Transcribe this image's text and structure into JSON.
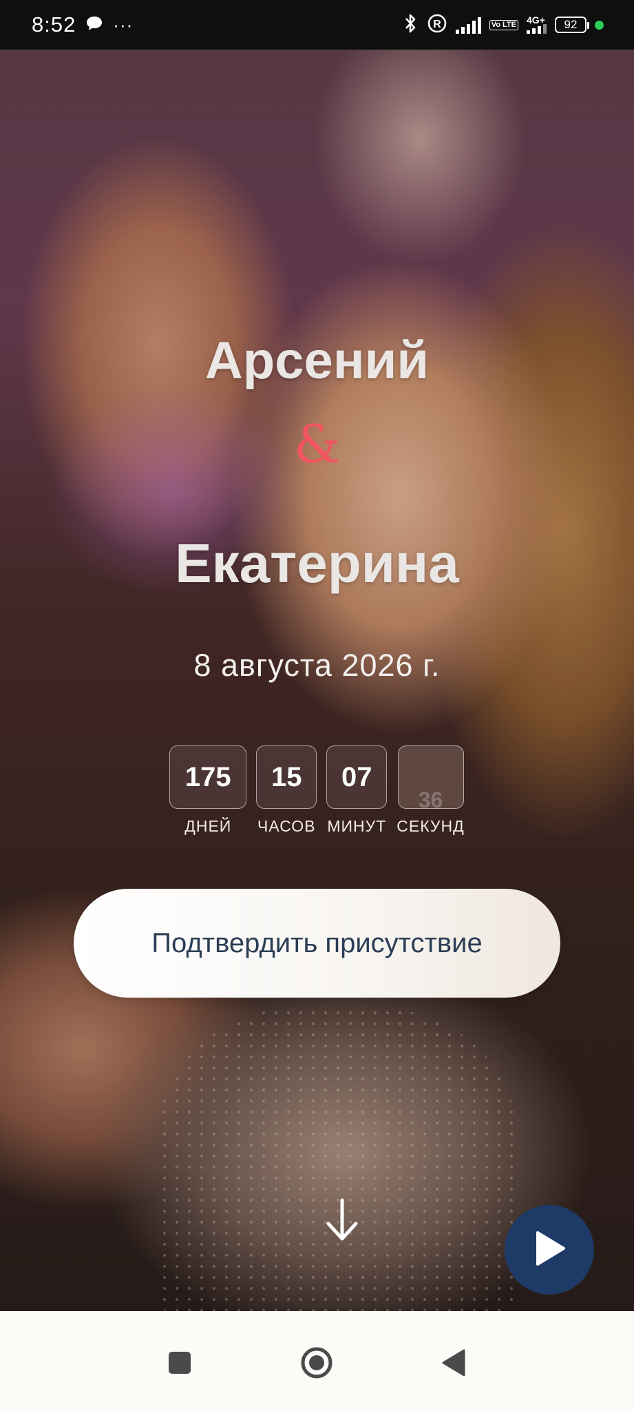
{
  "status_bar": {
    "time": "8:52",
    "chat_icon": "chat-bubble-icon",
    "more": "···",
    "volte": "Vo LTE",
    "network": "4G+",
    "battery": "92"
  },
  "invitation": {
    "name_groom": "Арсений",
    "ampersand": "&",
    "name_bride": "Екатерина",
    "date": "8 августа 2026 г.",
    "countdown": [
      {
        "value": "175",
        "label": "ДНЕЙ"
      },
      {
        "value": "15",
        "label": "ЧАСОВ"
      },
      {
        "value": "07",
        "label": "МИНУТ"
      },
      {
        "value": "36",
        "label": "СЕКУНД"
      }
    ],
    "rsvp_button": "Подтвердить присутствие"
  },
  "colors": {
    "ampersand": "#f25560",
    "play_button": "#1e3a66",
    "rsvp_text": "#2c3e55"
  }
}
